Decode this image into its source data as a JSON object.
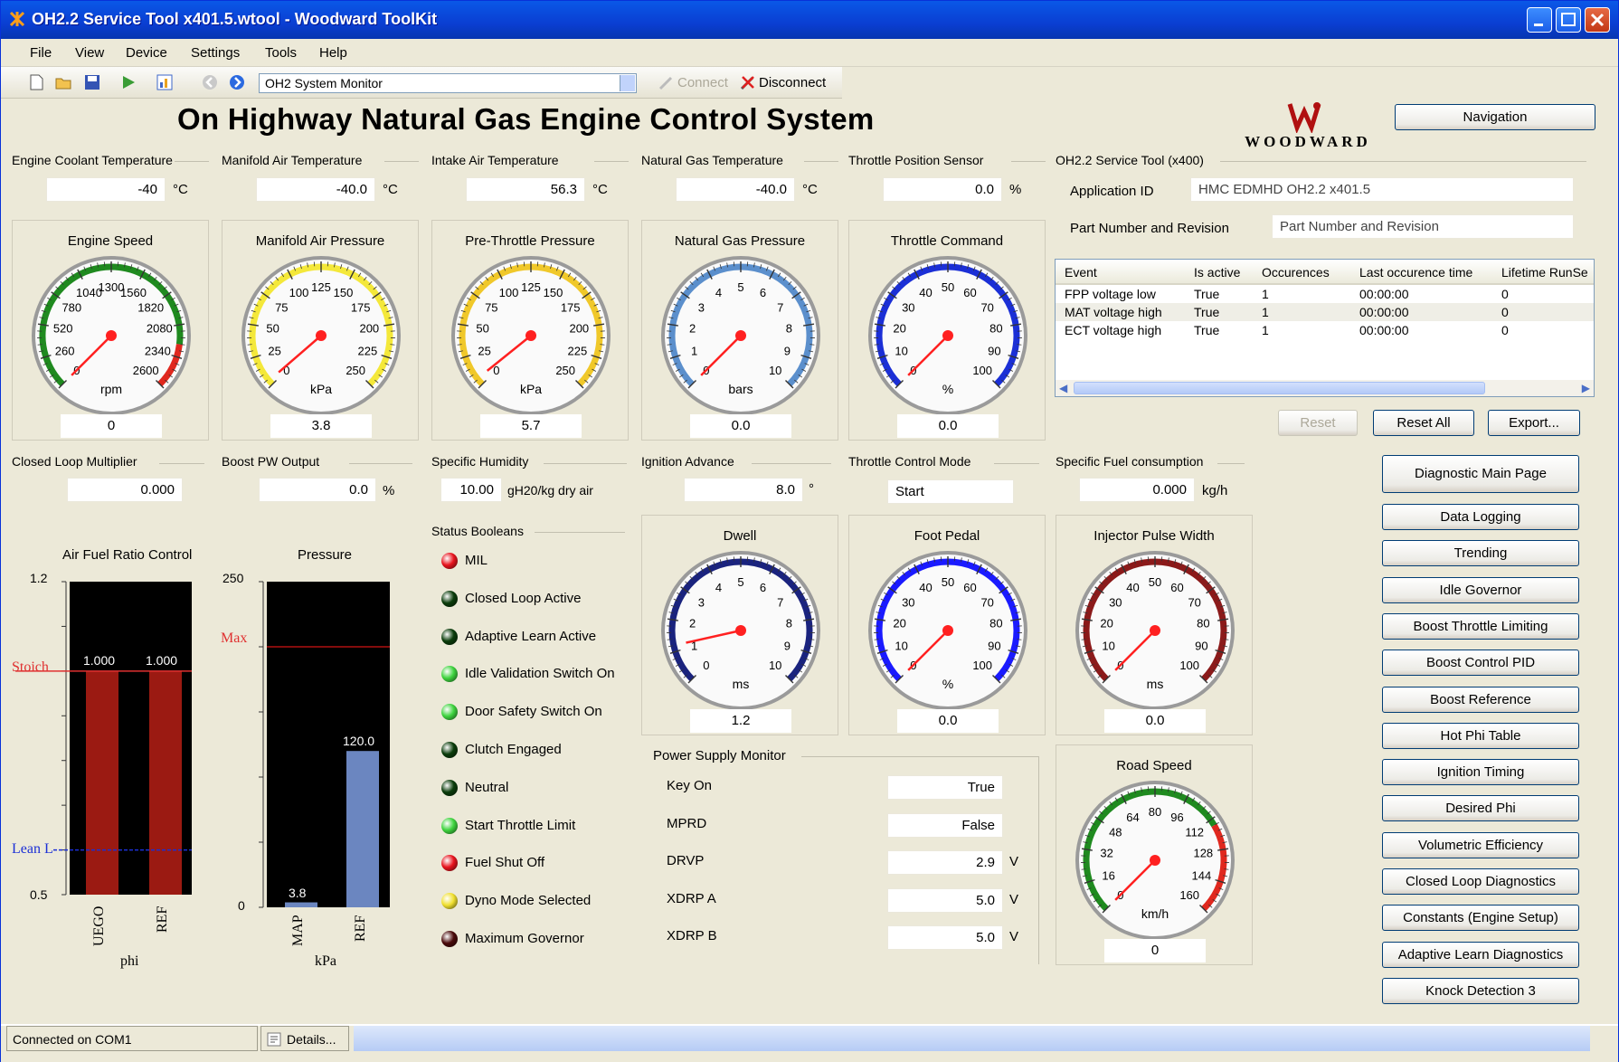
{
  "window": {
    "title": "OH2.2 Service Tool x401.5.wtool - Woodward ToolKit"
  },
  "menu": [
    "File",
    "View",
    "Device",
    "Settings",
    "Tools",
    "Help"
  ],
  "toolbar": {
    "page_select": "OH2 System Monitor",
    "connect_label": "Connect",
    "disconnect_label": "Disconnect"
  },
  "header": {
    "title": "On Highway Natural Gas Engine Control System",
    "logo_text": "WOODWARD",
    "navigation_label": "Navigation"
  },
  "temps": [
    {
      "label": "Engine Coolant Temperature",
      "value": "-40",
      "unit": "°C"
    },
    {
      "label": "Manifold Air Temperature",
      "value": "-40.0",
      "unit": "°C"
    },
    {
      "label": "Intake Air Temperature",
      "value": "56.3",
      "unit": "°C"
    },
    {
      "label": "Natural Gas Temperature",
      "value": "-40.0",
      "unit": "°C"
    },
    {
      "label": "Throttle Position Sensor",
      "value": "0.0",
      "unit": "%"
    }
  ],
  "service_tool": {
    "group_label": "OH2.2 Service Tool (x400)",
    "app_id_label": "Application ID",
    "app_id_value": "HMC EDMHD OH2.2 x401.5",
    "part_label": "Part Number and Revision",
    "part_value": "Part Number and Revision"
  },
  "gauges_row1": [
    {
      "title": "Engine Speed",
      "unit": "rpm",
      "value": "0",
      "value_num": 0,
      "min": 0,
      "max": 2600,
      "labels": [
        "0",
        "260",
        "520",
        "780",
        "1040",
        "1300",
        "1560",
        "1820",
        "2080",
        "2340",
        "2600"
      ],
      "arc_color": "#1f8a1f",
      "red_from": 0.86
    },
    {
      "title": "Manifold Air Pressure",
      "unit": "kPa",
      "value": "3.8",
      "value_num": 3.8,
      "min": 0,
      "max": 250,
      "labels": [
        "0",
        "25",
        "50",
        "75",
        "100",
        "125",
        "150",
        "175",
        "200",
        "225",
        "250"
      ],
      "arc_color": "#f4e83a"
    },
    {
      "title": "Pre-Throttle Pressure",
      "unit": "kPa",
      "value": "5.7",
      "value_num": 5.7,
      "min": 0,
      "max": 250,
      "labels": [
        "0",
        "25",
        "50",
        "75",
        "100",
        "125",
        "150",
        "175",
        "200",
        "225",
        "250"
      ],
      "arc_color": "#f0c82a"
    },
    {
      "title": "Natural Gas Pressure",
      "unit": "bars",
      "value": "0.0",
      "value_num": 0,
      "min": 0,
      "max": 10,
      "labels": [
        "0",
        "1",
        "2",
        "3",
        "4",
        "5",
        "6",
        "7",
        "8",
        "9",
        "10"
      ],
      "arc_color": "#5b8fcc"
    },
    {
      "title": "Throttle Command",
      "unit": "%",
      "value": "0.0",
      "value_num": 0,
      "min": 0,
      "max": 100,
      "labels": [
        "0",
        "10",
        "20",
        "30",
        "40",
        "50",
        "60",
        "70",
        "80",
        "90",
        "100"
      ],
      "arc_color": "#1b2fd6"
    }
  ],
  "events": {
    "columns": [
      "Event",
      "Is active",
      "Occurences",
      "Last occurence time",
      "Lifetime RunSe"
    ],
    "rows": [
      [
        "FPP voltage low",
        "True",
        "1",
        "00:00:00",
        "0"
      ],
      [
        "MAT voltage high",
        "True",
        "1",
        "00:00:00",
        "0"
      ],
      [
        "ECT voltage high",
        "True",
        "1",
        "00:00:00",
        "0"
      ]
    ],
    "reset_label": "Reset",
    "reset_all_label": "Reset All",
    "export_label": "Export..."
  },
  "row2": {
    "clm_label": "Closed Loop Multiplier",
    "clm_value": "0.000",
    "boost_label": "Boost PW Output",
    "boost_value": "0.0",
    "boost_unit": "%",
    "humidity_label": "Specific Humidity",
    "humidity_value": "10.00",
    "humidity_unit": "gH20/kg dry air",
    "ign_label": "Ignition Advance",
    "ign_value": "8.0",
    "ign_unit": "°",
    "tcm_label": "Throttle Control Mode",
    "tcm_value": "Start",
    "sfc_label": "Specific Fuel consumption",
    "sfc_value": "0.000",
    "sfc_unit": "kg/h"
  },
  "nav_buttons": [
    "Diagnostic Main Page",
    "Data Logging",
    "Trending",
    "Idle Governor",
    "Boost Throttle Limiting",
    "Boost Control PID",
    "Boost Reference",
    "Hot Phi Table",
    "Ignition Timing",
    "Desired Phi",
    "Volumetric Efficiency",
    "Closed Loop Diagnostics",
    "Constants (Engine Setup)",
    "Adaptive Learn Diagnostics",
    "Knock Detection 3"
  ],
  "afr_chart": {
    "title": "Air Fuel Ratio Control",
    "ymax_label": "1.2",
    "ymin_label": "0.5",
    "stoich_label": "Stoich",
    "lean_label": "Lean L",
    "xlabel": "phi",
    "chart_data": {
      "type": "bar",
      "categories": [
        "UEGO",
        "REF"
      ],
      "values": [
        1.0,
        1.0
      ],
      "value_labels": [
        "1.000",
        "1.000"
      ],
      "ylim": [
        0.5,
        1.2
      ],
      "stoich": 1.0,
      "lean": 0.6
    }
  },
  "pressure_chart": {
    "title": "Pressure",
    "ymax_label": "250",
    "ymin_label": "0",
    "max_label": "Max",
    "xlabel": "kPa",
    "chart_data": {
      "type": "bar",
      "categories": [
        "MAP",
        "REF"
      ],
      "values": [
        3.8,
        120.0
      ],
      "value_labels": [
        "3.8",
        "120.0"
      ],
      "ylim": [
        0,
        250
      ],
      "max_line": 200
    }
  },
  "status_booleans": {
    "label": "Status Booleans",
    "items": [
      {
        "label": "MIL",
        "color": "#e8141e"
      },
      {
        "label": "Closed Loop Active",
        "color": "#0b3d0b"
      },
      {
        "label": "Adaptive Learn Active",
        "color": "#0b3d0b"
      },
      {
        "label": "Idle Validation Switch On",
        "color": "#3fd43f"
      },
      {
        "label": "Door Safety Switch On",
        "color": "#3fd43f"
      },
      {
        "label": "Clutch Engaged",
        "color": "#0b3d0b"
      },
      {
        "label": "Neutral",
        "color": "#0b3d0b"
      },
      {
        "label": "Start Throttle Limit",
        "color": "#3fd43f"
      },
      {
        "label": "Fuel Shut Off",
        "color": "#e8141e"
      },
      {
        "label": "Dyno Mode Selected",
        "color": "#f0e030"
      },
      {
        "label": "Maximum Governor",
        "color": "#4a0a0a"
      }
    ]
  },
  "gauges_row2": [
    {
      "title": "Dwell",
      "unit": "ms",
      "value": "1.2",
      "value_num": 1.2,
      "min": 0,
      "max": 10,
      "labels": [
        "0",
        "1",
        "2",
        "3",
        "4",
        "5",
        "6",
        "7",
        "8",
        "9",
        "10"
      ],
      "arc_color": "#1a237e"
    },
    {
      "title": "Foot Pedal",
      "unit": "%",
      "value": "0.0",
      "value_num": 0,
      "min": 0,
      "max": 100,
      "labels": [
        "0",
        "10",
        "20",
        "30",
        "40",
        "50",
        "60",
        "70",
        "80",
        "90",
        "100"
      ],
      "arc_color": "#1a1aff"
    },
    {
      "title": "Injector Pulse Width",
      "unit": "ms",
      "value": "0.0",
      "value_num": 0,
      "min": 0,
      "max": 100,
      "labels": [
        "0",
        "10",
        "20",
        "30",
        "40",
        "50",
        "60",
        "70",
        "80",
        "90",
        "100"
      ],
      "arc_color": "#8b1a1a"
    }
  ],
  "road_speed": {
    "title": "Road Speed",
    "unit": "km/h",
    "value": "0",
    "value_num": 0,
    "min": 0,
    "max": 160,
    "labels": [
      "0",
      "16",
      "32",
      "48",
      "64",
      "80",
      "96",
      "112",
      "128",
      "144",
      "160"
    ],
    "arc_color": "#1f8a1f",
    "red_from": 0.72
  },
  "power_supply": {
    "label": "Power Supply Monitor",
    "rows": [
      {
        "label": "Key On",
        "value": "True",
        "unit": ""
      },
      {
        "label": "MPRD",
        "value": "False",
        "unit": ""
      },
      {
        "label": "DRVP",
        "value": "2.9",
        "unit": "V"
      },
      {
        "label": "XDRP A",
        "value": "5.0",
        "unit": "V"
      },
      {
        "label": "XDRP B",
        "value": "5.0",
        "unit": "V"
      }
    ]
  },
  "statusbar": {
    "connection": "Connected on COM1",
    "details": "Details..."
  }
}
